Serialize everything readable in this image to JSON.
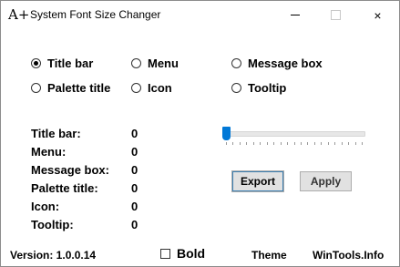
{
  "window": {
    "title": "System Font Size Changer",
    "app_icon": "A+"
  },
  "controls": {
    "minimize": "minimize-icon",
    "maximize": "maximize-icon",
    "close": "×"
  },
  "targets": [
    {
      "label": "Title bar",
      "selected": true
    },
    {
      "label": "Menu",
      "selected": false
    },
    {
      "label": "Message box",
      "selected": false
    },
    {
      "label": "Palette title",
      "selected": false
    },
    {
      "label": "Icon",
      "selected": false
    },
    {
      "label": "Tooltip",
      "selected": false
    }
  ],
  "sizes": [
    {
      "label": "Title bar:",
      "value": "0"
    },
    {
      "label": "Menu:",
      "value": "0"
    },
    {
      "label": "Message box:",
      "value": "0"
    },
    {
      "label": "Palette title:",
      "value": "0"
    },
    {
      "label": "Icon:",
      "value": "0"
    },
    {
      "label": "Tooltip:",
      "value": "0"
    }
  ],
  "slider": {
    "value": 0,
    "min": 0,
    "max": 20,
    "tick_count": 21,
    "accent": "#0078d7"
  },
  "buttons": {
    "export": "Export",
    "apply": "Apply"
  },
  "footer": {
    "version": "Version: 1.0.0.14",
    "bold": "Bold",
    "bold_checked": false,
    "theme": "Theme",
    "site": "WinTools.Info"
  }
}
